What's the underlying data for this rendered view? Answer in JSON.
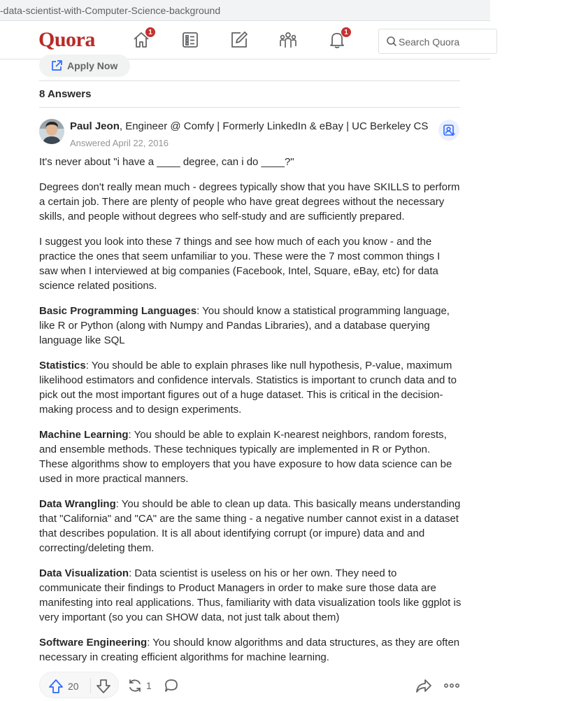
{
  "browser": {
    "url": "-data-scientist-with-Computer-Science-background"
  },
  "header": {
    "logo": "Quora",
    "home_badge": "1",
    "notifications_badge": "1",
    "search_placeholder": "Search Quora",
    "brand_color": "#b92b27"
  },
  "apply": {
    "label": "Apply Now"
  },
  "answers": {
    "count_label": "8 Answers"
  },
  "answer": {
    "author_name": "Paul Jeon",
    "author_credential": ", Engineer @ Comfy | Formerly LinkedIn & eBay | UC Berkeley CS",
    "date": "Answered April 22, 2016",
    "p1": "It's never about \"i have a ____ degree, can i do ____?\"",
    "p2": "Degrees don't really mean much - degrees typically show that you have SKILLS to perform a certain job. There are plenty of people who have great degrees without the necessary skills, and people without degrees who self-study and are sufficiently prepared.",
    "p3": "I suggest you look into these 7 things and see how much of each you know - and the practice the ones that seem unfamiliar to you. These were the 7 most common things I saw when I interviewed at big companies (Facebook, Intel, Square, eBay, etc) for data science related positions.",
    "items": [
      {
        "title": "Basic Programming Languages",
        "text": ": You should know a statistical programming language, like R or Python (along with Numpy and Pandas Libraries), and a database querying language like SQL"
      },
      {
        "title": "Statistics",
        "text": ": You should be able to explain phrases like null hypothesis, P-value, maximum likelihood estimators and confidence intervals. Statistics is important to crunch data and to pick out the most important figures out of a huge dataset. This is critical in the decision-making process and to design experiments."
      },
      {
        "title": "Machine Learning",
        "text": ": You should be able to explain K-nearest neighbors, random forests, and ensemble methods. These techniques typically are implemented in R or Python. These algorithms show to employers that you have exposure to how data science can be used in more practical manners."
      },
      {
        "title": "Data Wrangling",
        "text": ": You should be able to clean up data. This basically means understanding that \"California\" and \"CA\" are the same thing - a negative number cannot exist in a dataset that describes population. It is all about identifying corrupt (or impure) data and and correcting/deleting them."
      },
      {
        "title": "Data Visualization",
        "text": ": Data scientist is useless on his or her own. They need to communicate their findings to Product Managers in order to make sure those data are manifesting into real applications. Thus, familiarity with data visualization tools like ggplot is very important (so you can SHOW data, not just talk about them)"
      },
      {
        "title": "Software Engineering",
        "text": ": You should know algorithms and data structures, as they are often necessary in creating efficient algorithms for machine learning."
      }
    ]
  },
  "actions": {
    "upvotes": "20",
    "shares": "1"
  }
}
